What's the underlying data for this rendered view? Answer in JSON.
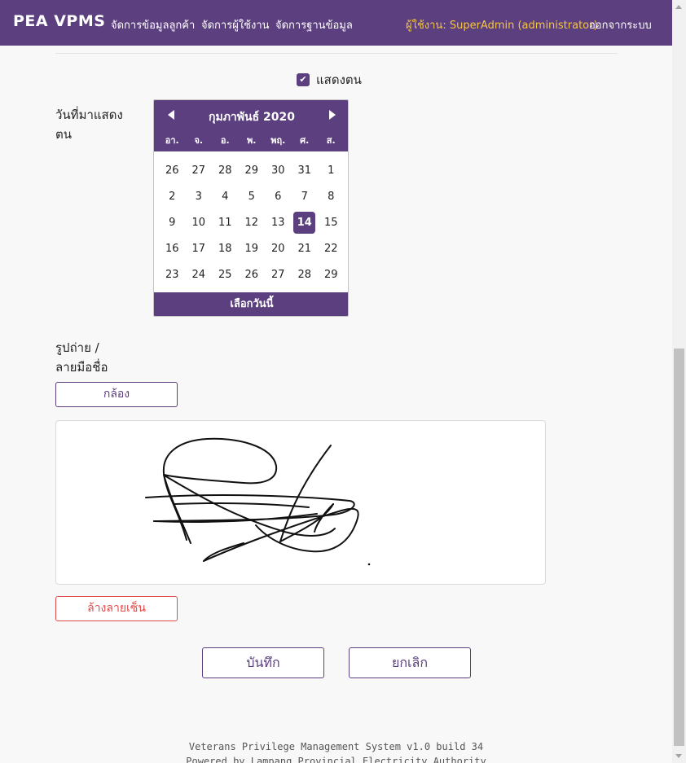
{
  "navbar": {
    "brand": "PEA VPMS",
    "links": [
      "จัดการข้อมูลลูกค้า",
      "จัดการผู้ใช้งาน",
      "จัดการฐานข้อมูล"
    ],
    "user": "ผู้ใช้งาน: SuperAdmin (administrator)",
    "logout": "ออกจากระบบ"
  },
  "form": {
    "show_label": "แสดงตน",
    "show_checked": true,
    "date_label": "วันที่มาแสดงตน",
    "photo_label": "รูปถ่าย / ลายมือชื่อ",
    "camera_button": "กล้อง",
    "clear_signature_button": "ล้างลายเซ็น",
    "save_button": "บันทึก",
    "cancel_button": "ยกเลิก"
  },
  "calendar": {
    "month_title": "กุมภาพันธ์ 2020",
    "weekdays": [
      "อา.",
      "จ.",
      "อ.",
      "พ.",
      "พฤ.",
      "ศ.",
      "ส."
    ],
    "days": [
      "26",
      "27",
      "28",
      "29",
      "30",
      "31",
      "1",
      "2",
      "3",
      "4",
      "5",
      "6",
      "7",
      "8",
      "9",
      "10",
      "11",
      "12",
      "13",
      "14",
      "15",
      "16",
      "17",
      "18",
      "19",
      "20",
      "21",
      "22",
      "23",
      "24",
      "25",
      "26",
      "27",
      "28",
      "29"
    ],
    "selected_day": "14",
    "today_button": "เลือกวันนี้"
  },
  "footer": {
    "line1": "Veterans Privilege Management System v1.0 build 34",
    "line2": "Powered by Lampang Provincial Electricity Authority"
  },
  "colors": {
    "primary": "#5b3f7e",
    "user_highlight": "#f5c542",
    "danger": "#e14a4a"
  }
}
